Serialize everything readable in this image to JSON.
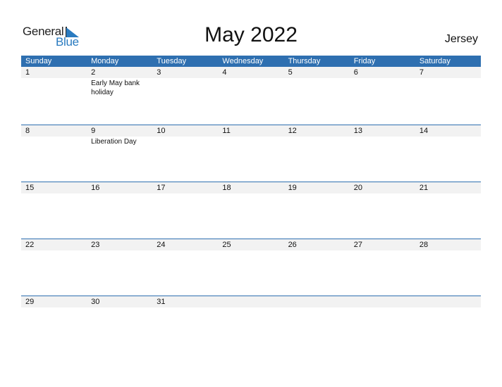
{
  "logo": {
    "general": "General",
    "blue": "Blue"
  },
  "title": "May 2022",
  "country": "Jersey",
  "weekdays": [
    "Sunday",
    "Monday",
    "Tuesday",
    "Wednesday",
    "Thursday",
    "Friday",
    "Saturday"
  ],
  "weeks": [
    [
      {
        "d": "1",
        "e": ""
      },
      {
        "d": "2",
        "e": "Early May bank holiday"
      },
      {
        "d": "3",
        "e": ""
      },
      {
        "d": "4",
        "e": ""
      },
      {
        "d": "5",
        "e": ""
      },
      {
        "d": "6",
        "e": ""
      },
      {
        "d": "7",
        "e": ""
      }
    ],
    [
      {
        "d": "8",
        "e": ""
      },
      {
        "d": "9",
        "e": "Liberation Day"
      },
      {
        "d": "10",
        "e": ""
      },
      {
        "d": "11",
        "e": ""
      },
      {
        "d": "12",
        "e": ""
      },
      {
        "d": "13",
        "e": ""
      },
      {
        "d": "14",
        "e": ""
      }
    ],
    [
      {
        "d": "15",
        "e": ""
      },
      {
        "d": "16",
        "e": ""
      },
      {
        "d": "17",
        "e": ""
      },
      {
        "d": "18",
        "e": ""
      },
      {
        "d": "19",
        "e": ""
      },
      {
        "d": "20",
        "e": ""
      },
      {
        "d": "21",
        "e": ""
      }
    ],
    [
      {
        "d": "22",
        "e": ""
      },
      {
        "d": "23",
        "e": ""
      },
      {
        "d": "24",
        "e": ""
      },
      {
        "d": "25",
        "e": ""
      },
      {
        "d": "26",
        "e": ""
      },
      {
        "d": "27",
        "e": ""
      },
      {
        "d": "28",
        "e": ""
      }
    ],
    [
      {
        "d": "29",
        "e": ""
      },
      {
        "d": "30",
        "e": ""
      },
      {
        "d": "31",
        "e": ""
      },
      {
        "d": "",
        "e": ""
      },
      {
        "d": "",
        "e": ""
      },
      {
        "d": "",
        "e": ""
      },
      {
        "d": "",
        "e": ""
      }
    ]
  ]
}
